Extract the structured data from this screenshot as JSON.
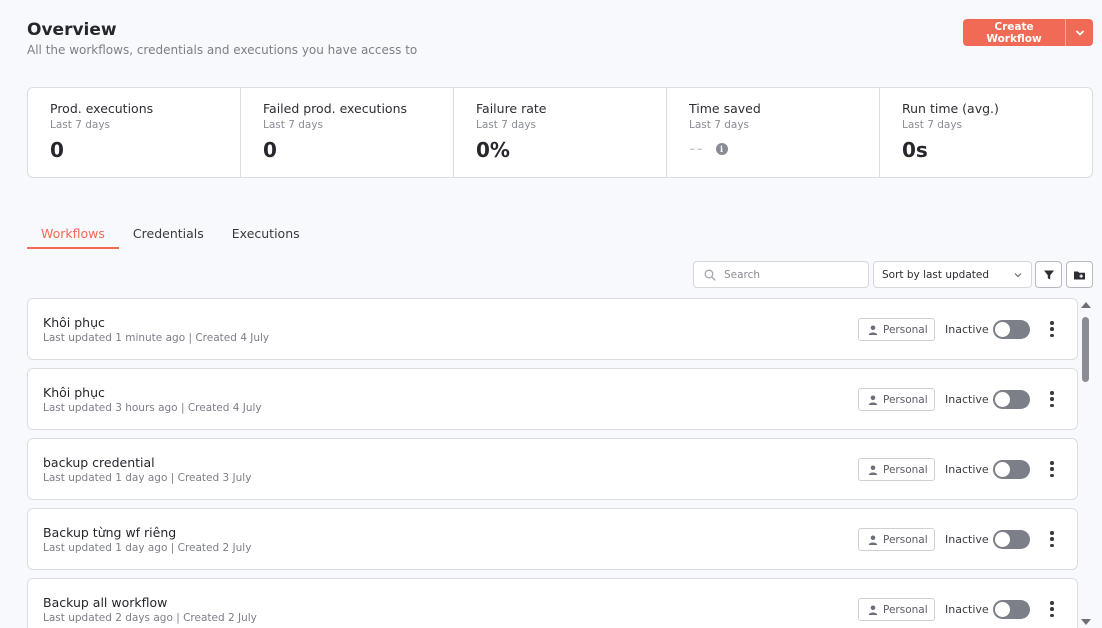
{
  "header": {
    "title": "Overview",
    "subtitle": "All the workflows, credentials and executions you have access to",
    "create_button": "Create Workflow"
  },
  "stats": [
    {
      "label": "Prod. executions",
      "period": "Last 7 days",
      "value": "0"
    },
    {
      "label": "Failed prod. executions",
      "period": "Last 7 days",
      "value": "0"
    },
    {
      "label": "Failure rate",
      "period": "Last 7 days",
      "value": "0%"
    },
    {
      "label": "Time saved",
      "period": "Last 7 days",
      "value": "--"
    },
    {
      "label": "Run time (avg.)",
      "period": "Last 7 days",
      "value": "0s"
    }
  ],
  "tabs": [
    {
      "label": "Workflows",
      "active": true
    },
    {
      "label": "Credentials",
      "active": false
    },
    {
      "label": "Executions",
      "active": false
    }
  ],
  "toolbar": {
    "search_placeholder": "Search",
    "sort_value": "Sort by last updated"
  },
  "workflows": [
    {
      "name": "Khôi phục",
      "meta": "Last updated 1 minute ago | Created 4 July",
      "owner": "Personal",
      "status": "Inactive"
    },
    {
      "name": "Khôi phục",
      "meta": "Last updated 3 hours ago | Created 4 July",
      "owner": "Personal",
      "status": "Inactive"
    },
    {
      "name": "backup credential",
      "meta": "Last updated 1 day ago | Created 3 July",
      "owner": "Personal",
      "status": "Inactive"
    },
    {
      "name": "Backup từng wf riêng",
      "meta": "Last updated 1 day ago | Created 2 July",
      "owner": "Personal",
      "status": "Inactive"
    },
    {
      "name": "Backup all workflow",
      "meta": "Last updated 2 days ago | Created 2 July",
      "owner": "Personal",
      "status": "Inactive"
    }
  ],
  "colors": {
    "accent": "#f06a55",
    "toggle_off": "#7d7f88"
  }
}
